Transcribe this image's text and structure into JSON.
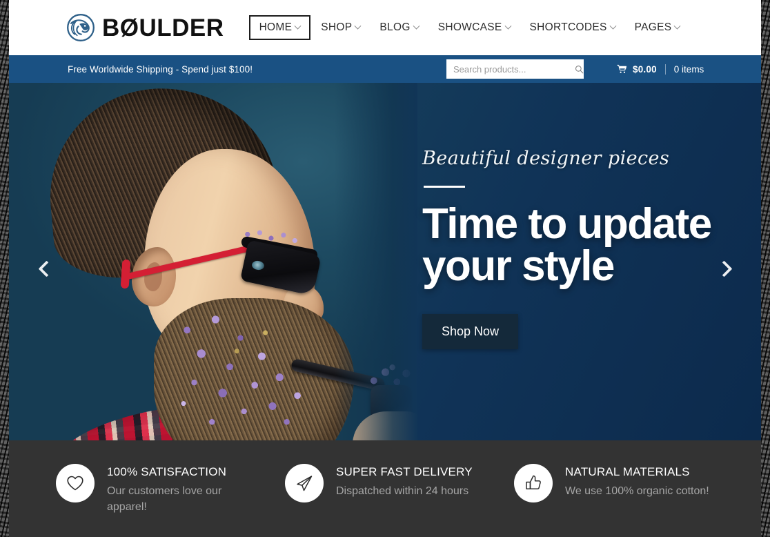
{
  "brand": {
    "name": "BØULDER",
    "logo_icon": "lion-head-circle-icon",
    "logo_color": "#2e6089"
  },
  "nav": {
    "items": [
      {
        "label": "HOME",
        "active": true,
        "has_dropdown": true
      },
      {
        "label": "SHOP",
        "active": false,
        "has_dropdown": true
      },
      {
        "label": "BLOG",
        "active": false,
        "has_dropdown": true
      },
      {
        "label": "SHOWCASE",
        "active": false,
        "has_dropdown": true
      },
      {
        "label": "SHORTCODES",
        "active": false,
        "has_dropdown": true
      },
      {
        "label": "PAGES",
        "active": false,
        "has_dropdown": true
      }
    ]
  },
  "utilbar": {
    "background_color": "#1a5183",
    "shipping_message": "Free Worldwide Shipping - Spend just $100!",
    "search": {
      "placeholder": "Search products...",
      "value": "",
      "icon": "search-icon"
    },
    "cart": {
      "icon": "shopping-cart-icon",
      "total": "$0.00",
      "items": "0 items"
    }
  },
  "hero": {
    "subtitle": "Beautiful designer pieces",
    "title_line1": "Time to update",
    "title_line2": "your style",
    "button_label": "Shop Now",
    "button_color": "#14293a",
    "prev_icon": "chevron-left-icon",
    "next_icon": "chevron-right-icon",
    "image_alt": "Bearded man in profile wearing red sunglasses with purple flowers in his beard, smoking a flower-filled pipe"
  },
  "features": {
    "background_color": "#333333",
    "items": [
      {
        "icon": "heart-icon",
        "title": "100% SATISFACTION",
        "description": "Our customers love our apparel!"
      },
      {
        "icon": "paper-plane-icon",
        "title": "SUPER FAST DELIVERY",
        "description": "Dispatched within 24 hours"
      },
      {
        "icon": "thumbs-up-icon",
        "title": "NATURAL MATERIALS",
        "description": "We use 100% organic cotton!"
      }
    ]
  }
}
